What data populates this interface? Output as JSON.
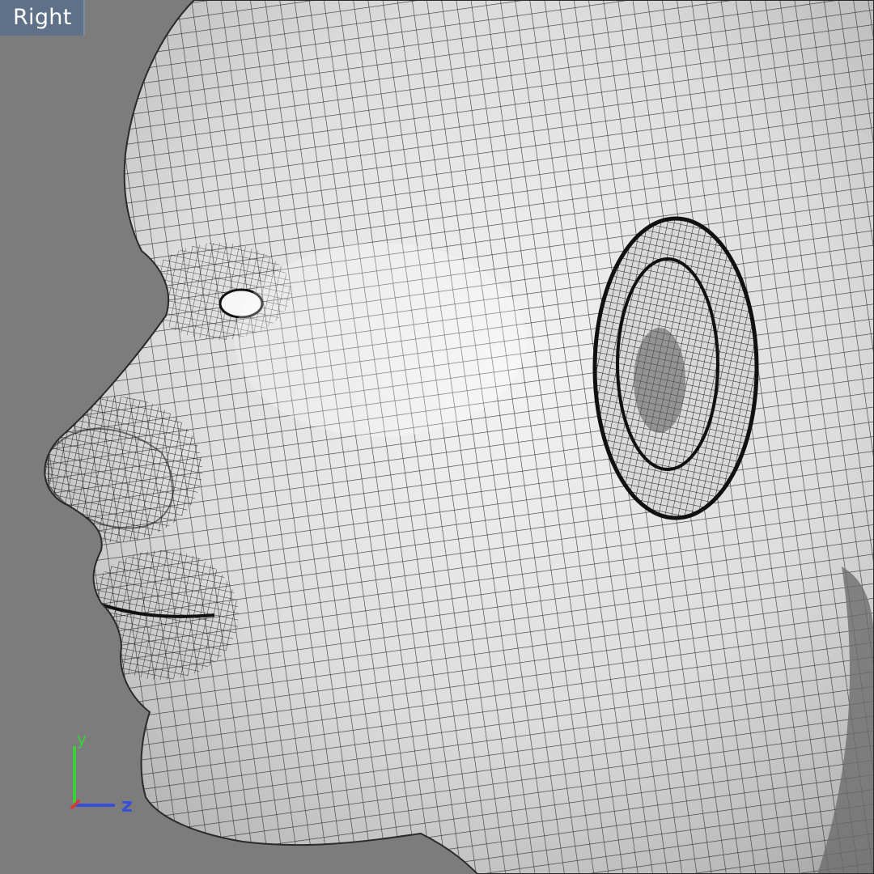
{
  "viewport": {
    "view_label": "Right",
    "background_color": "#7c7c7c",
    "label_color": "#5f7189",
    "content": "wireframe-head-model"
  },
  "axis_gizmo": {
    "y_label": "y",
    "z_label": "z",
    "y_color": "#3ccf3c",
    "z_color": "#3a4fd8",
    "x_color": "#d23a3a"
  }
}
